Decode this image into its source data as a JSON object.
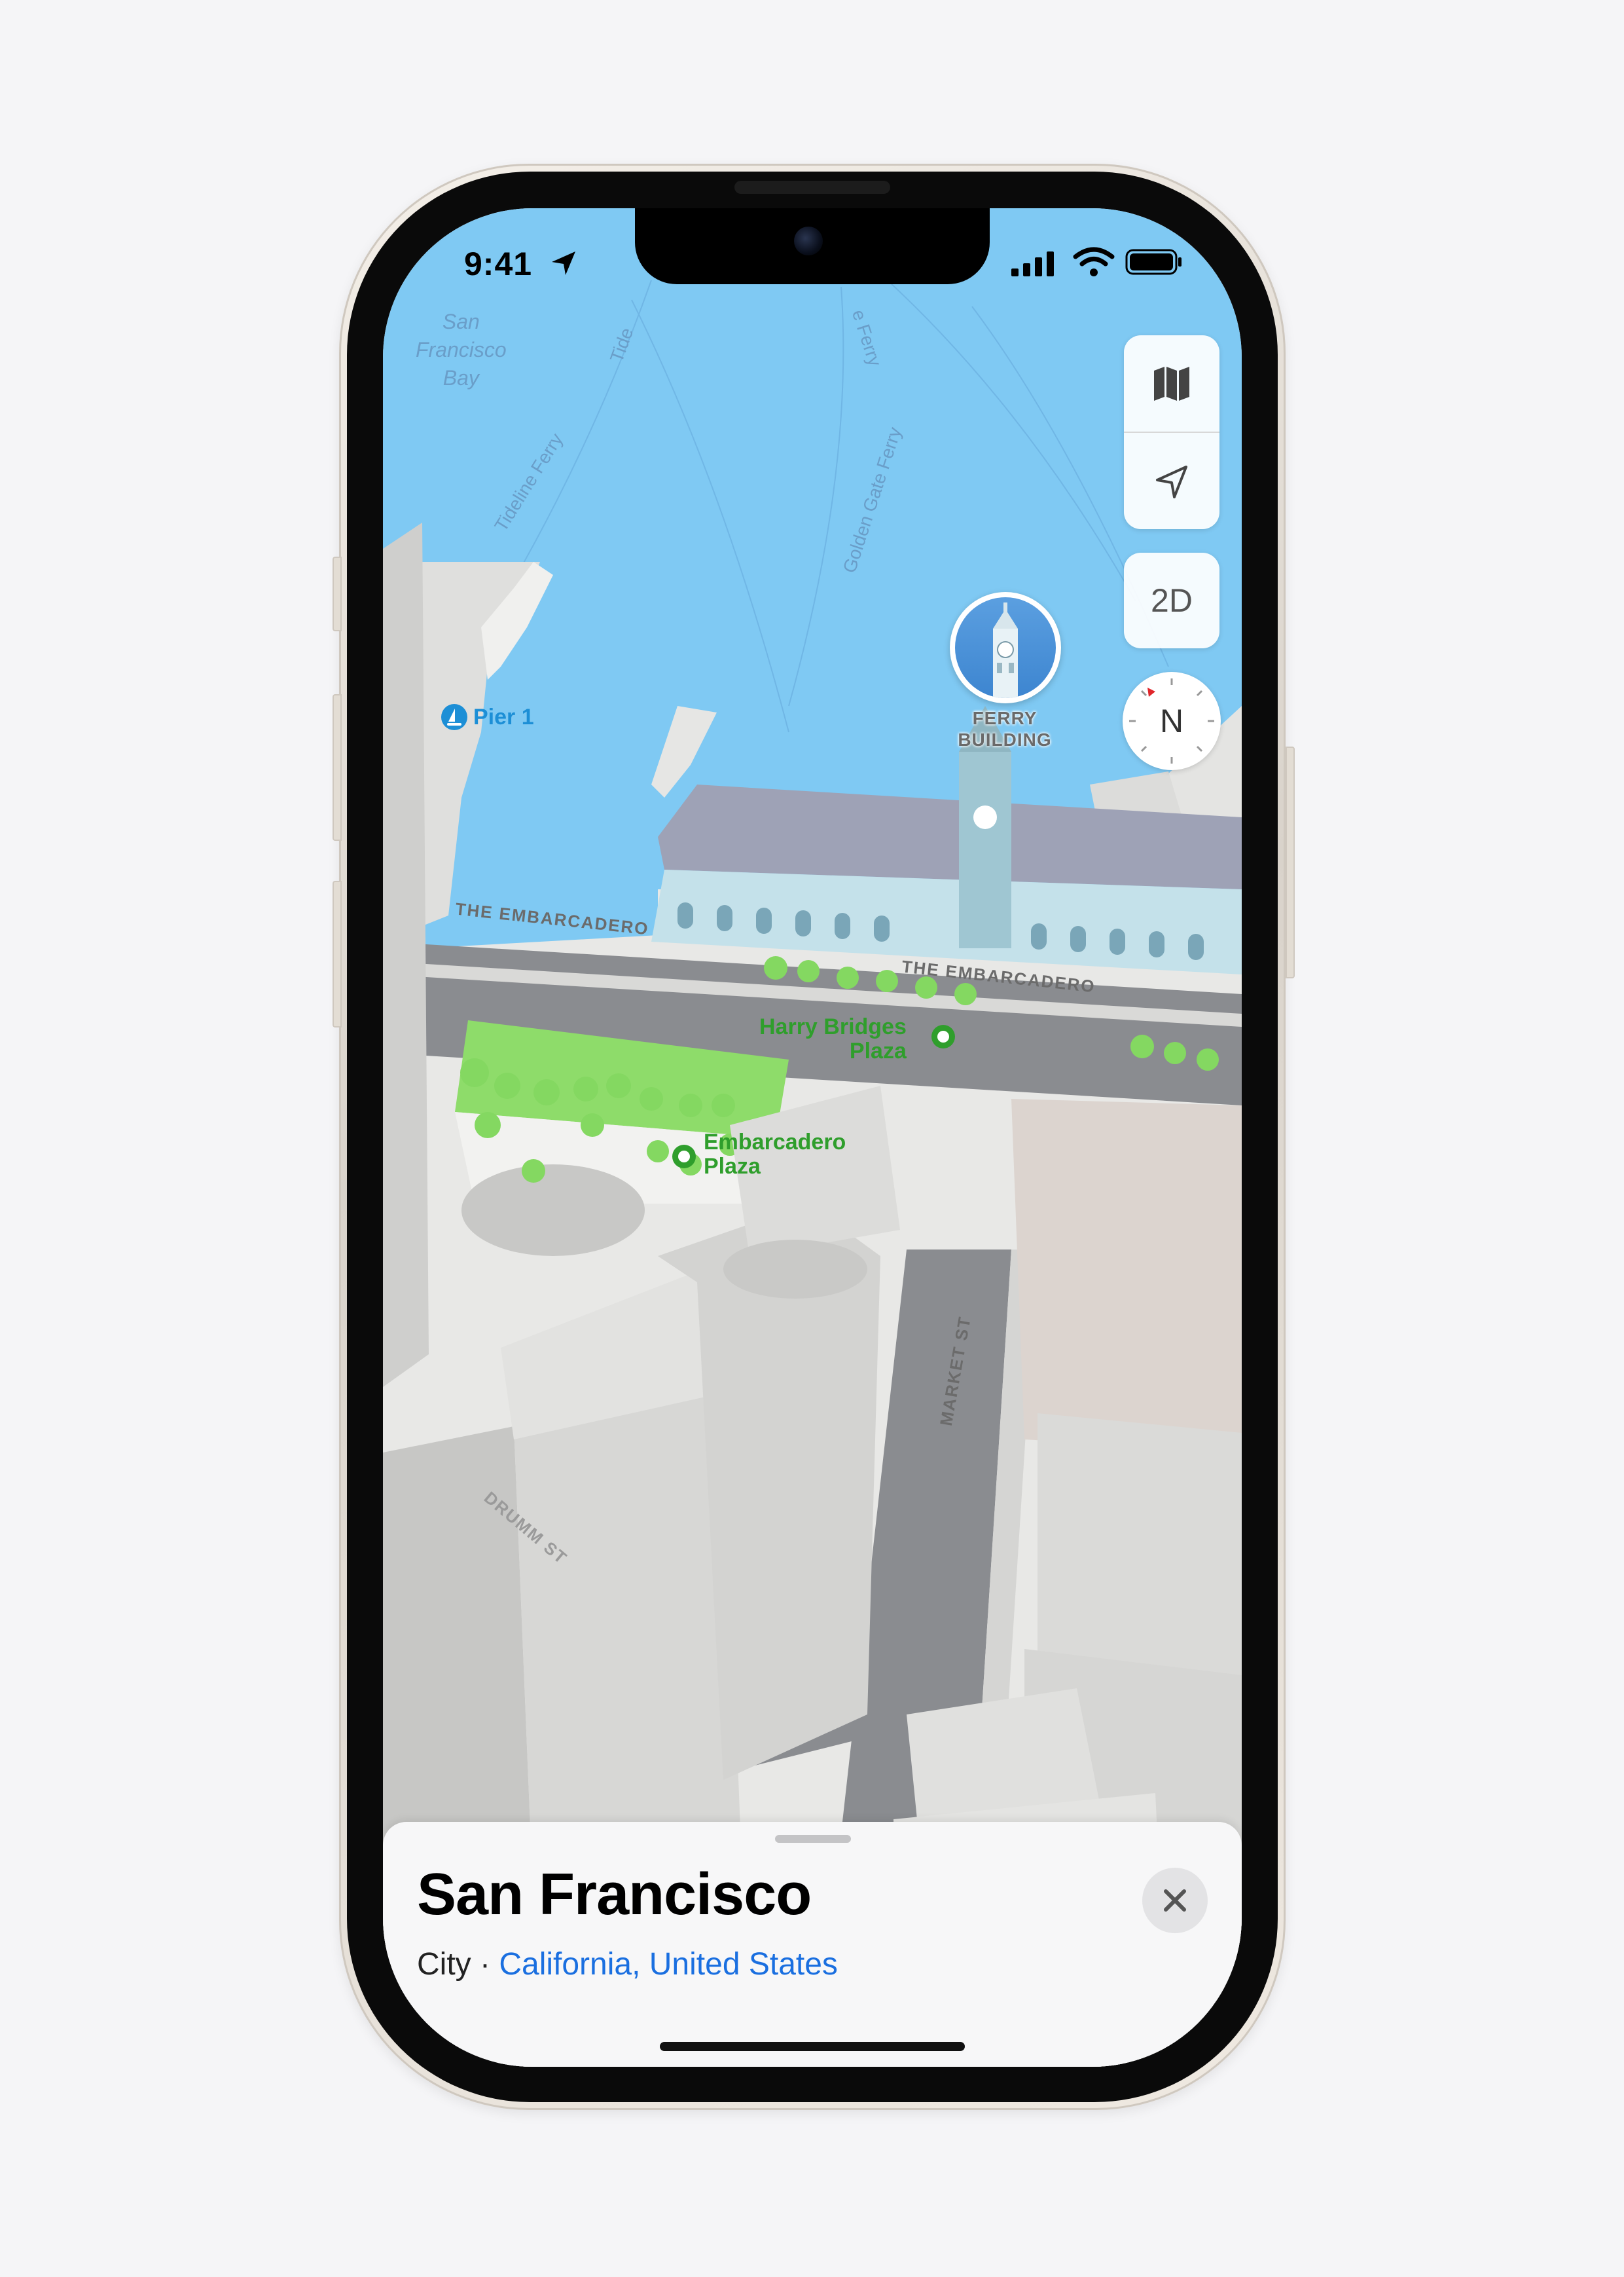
{
  "status_bar": {
    "time": "9:41"
  },
  "map": {
    "water_label": [
      "San",
      "Francisco",
      "Bay"
    ],
    "ferry_routes": [
      "Tideline Ferry",
      "Tide",
      "Golden Gate Ferry",
      "e Ferry"
    ],
    "streets": [
      "THE EMBARCADERO",
      "THE EMBARCADERO",
      "MARKET ST",
      "DRUMM ST"
    ],
    "pois": {
      "pier": "Pier 1",
      "harry_bridges": [
        "Harry Bridges",
        "Plaza"
      ],
      "embarcadero_plaza": [
        "Embarcadero",
        "Plaza"
      ]
    },
    "landmark": [
      "FERRY",
      "BUILDING"
    ]
  },
  "controls": {
    "map_mode_icon": "map-icon",
    "location_icon": "location-arrow-icon",
    "view_toggle": "2D",
    "compass_heading": "N"
  },
  "sheet": {
    "title": "San Francisco",
    "type": "City",
    "separator": " · ",
    "region": "California, United States"
  },
  "colors": {
    "water": "#7fc9f3",
    "park": "#8edc6a",
    "link": "#1a6fe0",
    "poi_green": "#2f9e2c",
    "poi_blue": "#1d8fd6"
  }
}
